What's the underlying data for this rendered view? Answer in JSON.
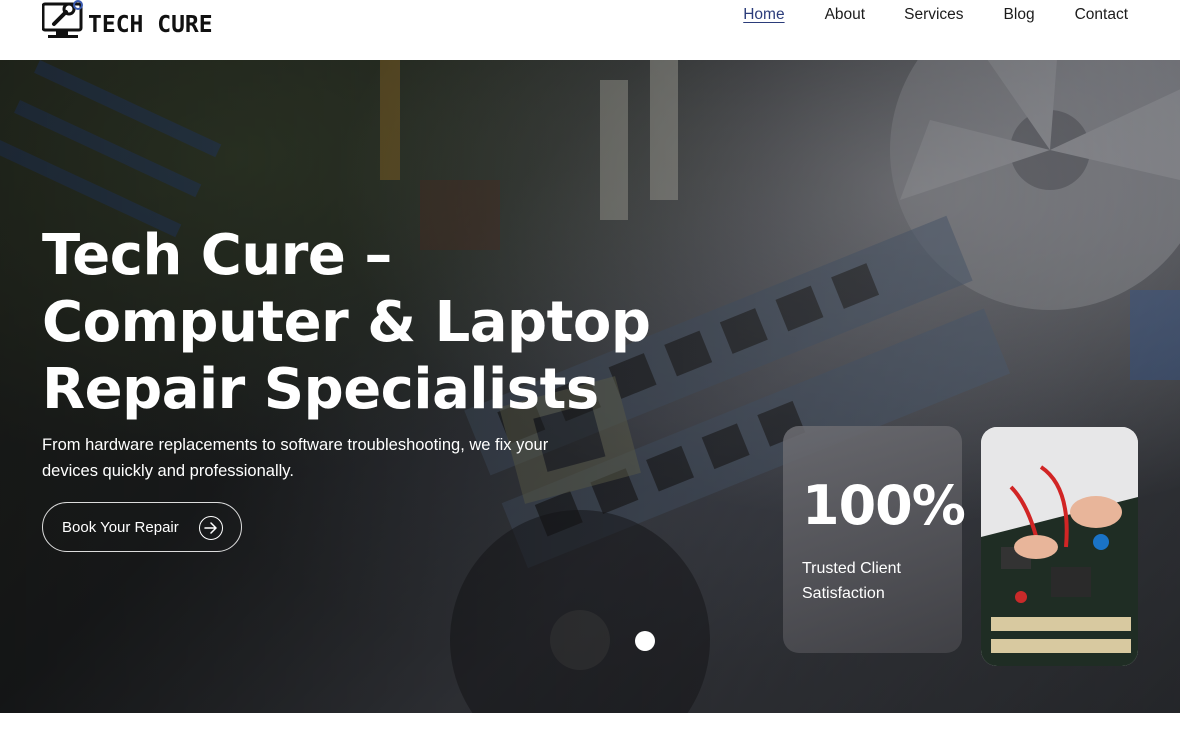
{
  "brand": {
    "name": "TECH CURE",
    "logo_icon": "monitor-wrench-icon"
  },
  "nav": {
    "items": [
      {
        "label": "Home",
        "active": true
      },
      {
        "label": "About",
        "active": false
      },
      {
        "label": "Services",
        "active": false
      },
      {
        "label": "Blog",
        "active": false
      },
      {
        "label": "Contact",
        "active": false
      }
    ]
  },
  "hero": {
    "title_line1": "Tech Cure –",
    "title_line2": "Computer & Laptop",
    "title_line3": "Repair Specialists",
    "subtitle": "From hardware replacements to software troubleshooting, we fix your devices quickly and professionally.",
    "cta_label": "Book Your Repair",
    "cta_icon": "arrow-right-circle-icon"
  },
  "stat": {
    "value": "100%",
    "label": "Trusted Client Satisfaction"
  },
  "photo": {
    "icon": "circuit-board-repair-photo"
  },
  "colors": {
    "active_nav": "#2b3c7a",
    "text": "#1c1c1c",
    "hero_text": "#ffffff"
  }
}
